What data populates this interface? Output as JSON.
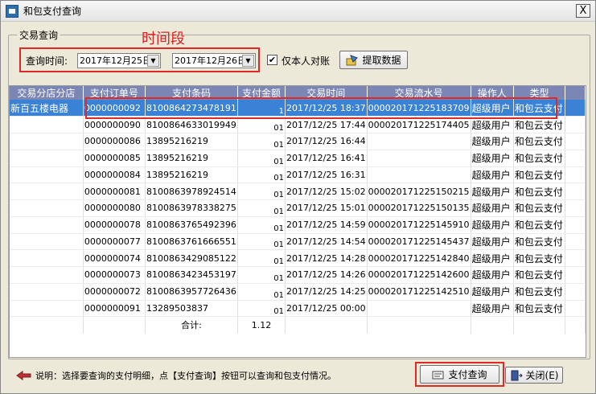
{
  "window": {
    "title": "和包支付查询",
    "close_glyph": "X"
  },
  "group": {
    "label": "交易查询"
  },
  "annotation": {
    "text": "时间段",
    "color": "#e02020"
  },
  "query": {
    "time_label": "查询时间:",
    "start_date": "2017年12月25日",
    "end_date": "2017年12月26日",
    "only_self_checked": true,
    "only_self_label": "仅本人对账",
    "fetch_label": "提取数据"
  },
  "table": {
    "columns": [
      "交易分店分店",
      "支付订单号",
      "支付条码",
      "支付金额",
      "交易时间",
      "交易流水号",
      "操作人",
      "类型"
    ],
    "rows": [
      [
        "新百五楼电器",
        "0000000092",
        "8100864273478191",
        "1",
        "2017/12/25  18:37",
        "000020171225183709",
        "超级用户",
        "和包云支付"
      ],
      [
        "",
        "0000000090",
        "8100864633019949",
        "01",
        "2017/12/25  17:44",
        "000020171225174405",
        "超级用户",
        "和包云支付"
      ],
      [
        "",
        "0000000086",
        "13895216219",
        "01",
        "2017/12/25  16:44",
        "",
        "超级用户",
        "和包云支付"
      ],
      [
        "",
        "0000000085",
        "13895216219",
        "01",
        "2017/12/25  16:41",
        "",
        "超级用户",
        "和包云支付"
      ],
      [
        "",
        "0000000084",
        "13895216219",
        "01",
        "2017/12/25  16:31",
        "",
        "超级用户",
        "和包云支付"
      ],
      [
        "",
        "0000000081",
        "8100863978924514",
        "01",
        "2017/12/25  15:02",
        "000020171225150215",
        "超级用户",
        "和包云支付"
      ],
      [
        "",
        "0000000080",
        "8100863978338275",
        "01",
        "2017/12/25  15:01",
        "000020171225150135",
        "超级用户",
        "和包云支付"
      ],
      [
        "",
        "0000000078",
        "8100863765492396",
        "01",
        "2017/12/25  14:59",
        "000020171225145910",
        "超级用户",
        "和包云支付"
      ],
      [
        "",
        "0000000077",
        "8100863761666551",
        "01",
        "2017/12/25  14:54",
        "000020171225145437",
        "超级用户",
        "和包云支付"
      ],
      [
        "",
        "0000000074",
        "8100863429085122",
        "01",
        "2017/12/25  14:28",
        "000020171225142840",
        "超级用户",
        "和包云支付"
      ],
      [
        "",
        "0000000073",
        "8100863423453197",
        "01",
        "2017/12/25  14:26",
        "000020171225142600",
        "超级用户",
        "和包云支付"
      ],
      [
        "",
        "0000000072",
        "8100863957726436",
        "01",
        "2017/12/25  14:25",
        "000020171225142510",
        "超级用户",
        "和包云支付"
      ],
      [
        "",
        "0000000091",
        "13289503837",
        "01",
        "2017/12/25  00:00",
        "",
        "超级用户",
        "和包云支付"
      ]
    ],
    "total_label": "合计:",
    "total_value": "1.12"
  },
  "footer": {
    "hint": "说明：选择要查询的支付明细，点【支付查询】按钮可以查询和包支付情况。",
    "query_button": "支付查询",
    "close_button": "关闭(E)"
  },
  "colors": {
    "header_bg": "#7b86b5",
    "selected_row": "#3a82d6",
    "highlight": "#e02828"
  }
}
